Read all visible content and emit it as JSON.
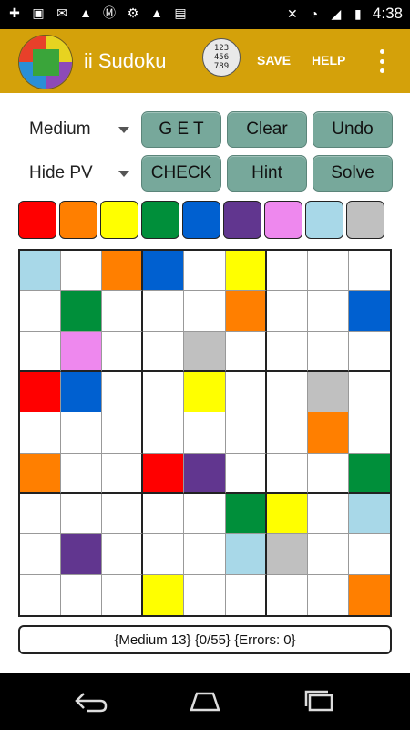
{
  "status_bar": {
    "time": "4:38",
    "left_icons": [
      "plus-icon",
      "image-icon",
      "gmail-icon",
      "signal-app-icon",
      "motorola-icon",
      "settings-icon",
      "signal-app-icon",
      "briefcase-icon"
    ],
    "right_icons": [
      "mute-icon",
      "wifi-icon",
      "cell-signal-icon",
      "battery-icon"
    ]
  },
  "app_bar": {
    "title": "ii Sudoku",
    "save_label": "SAVE",
    "help_label": "HELP",
    "ball_digits": "123\n456\n789"
  },
  "controls": {
    "difficulty_value": "Medium",
    "pv_value": "Hide PV",
    "get_label": "G E T",
    "clear_label": "Clear",
    "undo_label": "Undo",
    "check_label": "CHECK",
    "hint_label": "Hint",
    "solve_label": "Solve"
  },
  "palette": [
    "#ff0000",
    "#ff7f00",
    "#ffff00",
    "#008f3a",
    "#0060d0",
    "#61368f",
    "#ee88ee",
    "#a8d8e8",
    "#c0c0c0"
  ],
  "board": [
    [
      "#a8d8e8",
      "",
      "#ff7f00",
      "#0060d0",
      "",
      "#ffff00",
      "",
      "",
      ""
    ],
    [
      "",
      "#008f3a",
      "",
      "",
      "",
      "#ff7f00",
      "",
      "",
      "#0060d0"
    ],
    [
      "",
      "#ee88ee",
      "",
      "",
      "#c0c0c0",
      "",
      "",
      "",
      ""
    ],
    [
      "#ff0000",
      "#0060d0",
      "",
      "",
      "#ffff00",
      "",
      "",
      "#c0c0c0",
      ""
    ],
    [
      "",
      "",
      "",
      "",
      "",
      "",
      "",
      "#ff7f00",
      ""
    ],
    [
      "#ff7f00",
      "",
      "",
      "#ff0000",
      "#61368f",
      "",
      "",
      "",
      "#008f3a"
    ],
    [
      "",
      "",
      "",
      "",
      "",
      "#008f3a",
      "#ffff00",
      "",
      "#a8d8e8"
    ],
    [
      "",
      "#61368f",
      "",
      "",
      "",
      "#a8d8e8",
      "#c0c0c0",
      "",
      ""
    ],
    [
      "",
      "",
      "",
      "#ffff00",
      "",
      "",
      "",
      "",
      "#ff7f00"
    ]
  ],
  "status_text": "{Medium 13} {0/55} {Errors: 0}",
  "colors": {
    "app_bar": "#d4a10a",
    "button": "#77a89b"
  }
}
